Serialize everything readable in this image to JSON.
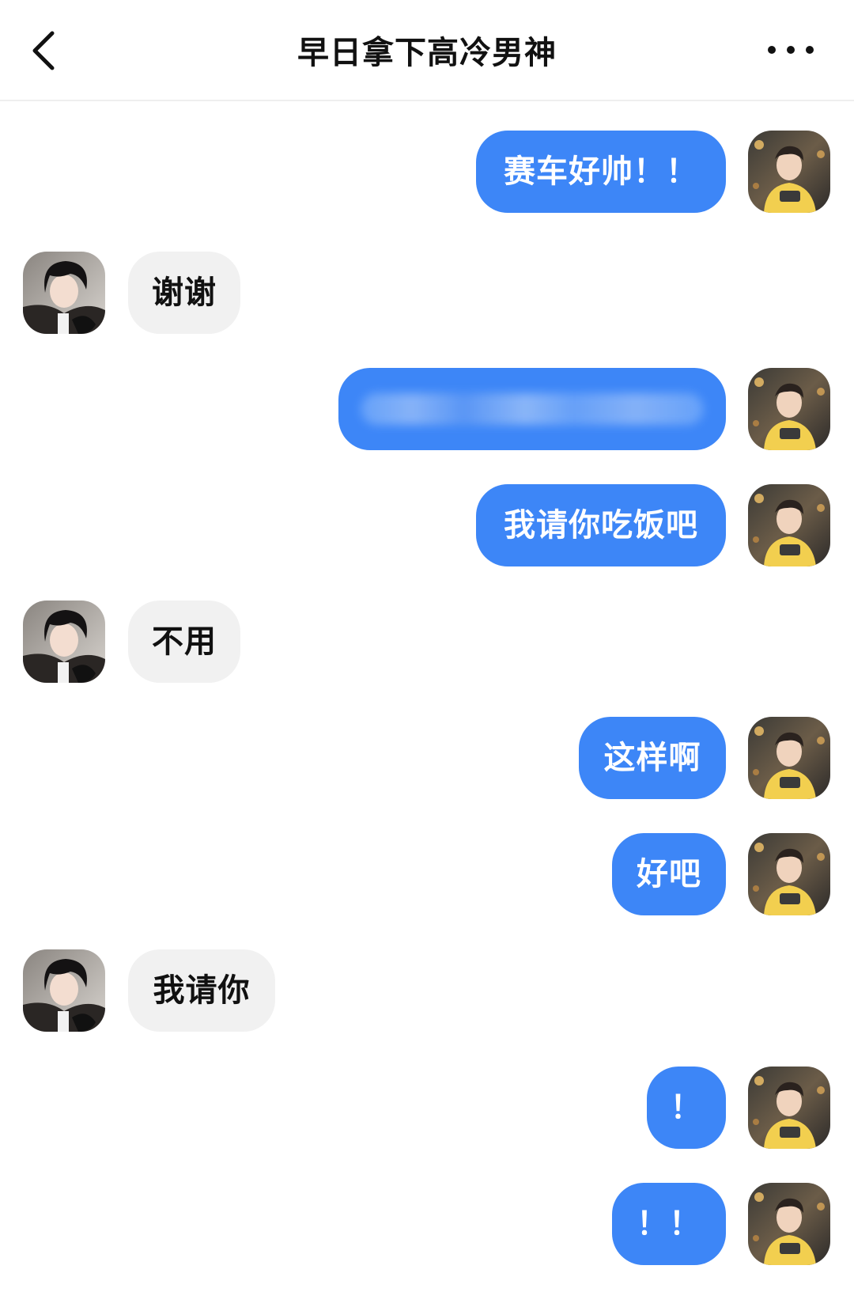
{
  "header": {
    "title": "早日拿下高冷男神",
    "back_icon": "chevron-left-icon",
    "more_icon": "more-horizontal-icon"
  },
  "messages": [
    {
      "sender": "me",
      "text": "赛车好帅！！"
    },
    {
      "sender": "other",
      "text": "谢谢"
    },
    {
      "sender": "me",
      "text": "",
      "redacted": true
    },
    {
      "sender": "me",
      "text": "我请你吃饭吧"
    },
    {
      "sender": "other",
      "text": "不用"
    },
    {
      "sender": "me",
      "text": "这样啊"
    },
    {
      "sender": "me",
      "text": "好吧"
    },
    {
      "sender": "other",
      "text": "我请你"
    },
    {
      "sender": "me",
      "text": "！"
    },
    {
      "sender": "me",
      "text": "！！"
    }
  ],
  "colors": {
    "my_bubble": "#3d86f7",
    "their_bubble": "#f1f1f1",
    "background": "#ffffff"
  }
}
